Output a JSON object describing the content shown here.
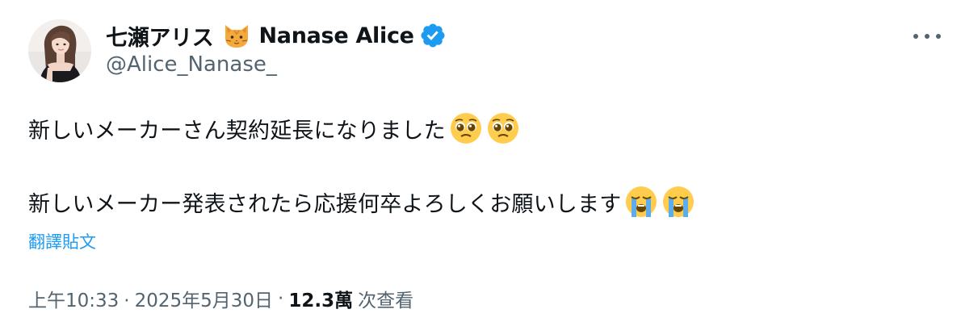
{
  "author": {
    "display_name": "七瀬アリス",
    "display_name_en": "Nanase Alice",
    "handle": "@Alice_Nanase_",
    "name_emoji": "cat-face",
    "verified": true,
    "verified_color": "#1d9bf0"
  },
  "tweet": {
    "line1": "新しいメーカーさん契約延長になりました",
    "line1_emojis": [
      "pleading-face",
      "pleading-face"
    ],
    "line2": "新しいメーカー発表されたら応援何卒よろしくお願いします",
    "line2_emojis": [
      "loudly-crying-face",
      "loudly-crying-face"
    ]
  },
  "translate_label": "翻譯貼文",
  "meta": {
    "time": "上午10:33",
    "separator": "·",
    "date": "2025年5月30日",
    "views_count": "12.3萬",
    "views_label": "次查看"
  },
  "colors": {
    "text_primary": "#0f1419",
    "text_secondary": "#536471",
    "link": "#1d9bf0"
  }
}
